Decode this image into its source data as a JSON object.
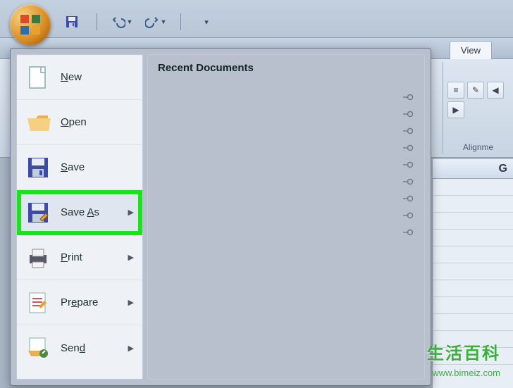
{
  "qat": {
    "save_tooltip": "Save",
    "undo_tooltip": "Undo",
    "redo_tooltip": "Redo"
  },
  "ribbon": {
    "visible_tab": "View",
    "group_label": "Alignme"
  },
  "office_menu": {
    "items": [
      {
        "label": "New",
        "underline": "N",
        "arrow": false
      },
      {
        "label": "Open",
        "underline": "O",
        "arrow": false
      },
      {
        "label": "Save",
        "underline": "S",
        "arrow": false
      },
      {
        "label": "Save As",
        "underline": "A",
        "arrow": true,
        "highlighted": true
      },
      {
        "label": "Print",
        "underline": "P",
        "arrow": true
      },
      {
        "label": "Prepare",
        "underline": "E",
        "arrow": true
      },
      {
        "label": "Send",
        "underline": "D",
        "arrow": true
      }
    ],
    "recent_header": "Recent Documents",
    "recent_pins_count": 9
  },
  "sheet": {
    "visible_col_fragment": "G"
  },
  "watermark": {
    "cn": "生活百科",
    "url": "www.bimeiz.com"
  }
}
